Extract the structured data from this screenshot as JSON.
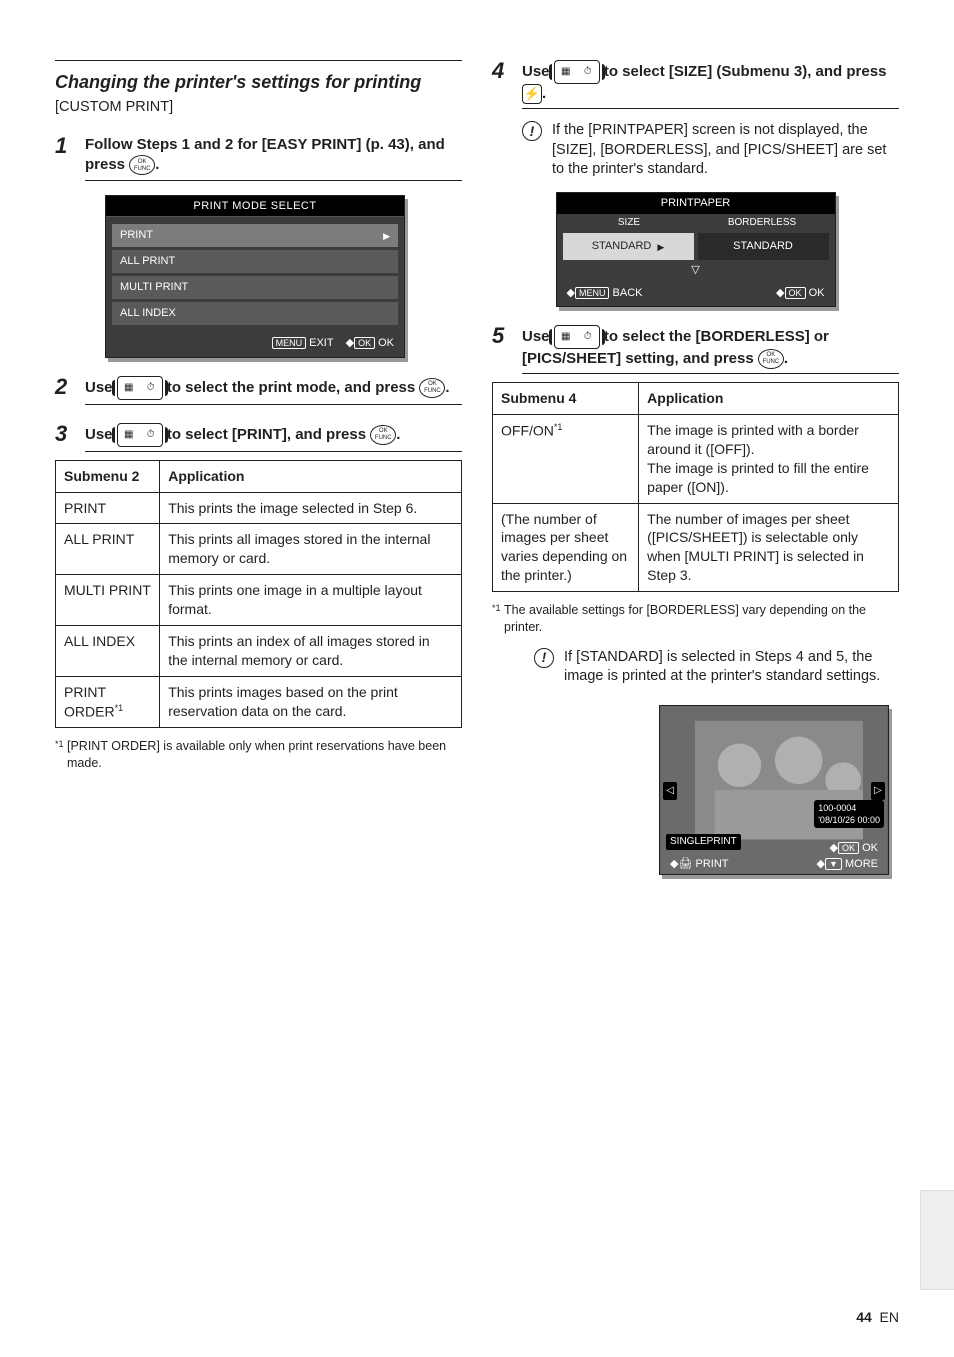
{
  "left": {
    "heading1": "Changing the printer's settings for printing",
    "heading1_sub": "[CUSTOM PRINT]",
    "step1_text_a": "Follow Steps 1 and 2 for [EASY PRINT] (p. 43), and press ",
    "step1_text_b": ".",
    "menu_title": "PRINT MODE SELECT",
    "menu_items": [
      "PRINT",
      "ALL PRINT",
      "MULTI PRINT",
      "ALL INDEX"
    ],
    "menu_foot_exit": "EXIT",
    "menu_foot_ok": "OK",
    "step2_text_a": "Use ",
    "step2_text_b": " to select the print mode, and press ",
    "step2_text_c": ".",
    "step3_text_a": "Use ",
    "step3_text_b": " to select [PRINT], and press ",
    "step3_text_c": ".",
    "table_hdr1": "Submenu 2",
    "table_hdr2": "Application",
    "table": [
      {
        "k": "PRINT",
        "v": "This prints the image selected in Step 6."
      },
      {
        "k": "ALL PRINT",
        "v": "This prints all images stored in the internal memory or card."
      },
      {
        "k": "MULTI PRINT",
        "v": "This prints one image in a multiple layout format."
      },
      {
        "k": "ALL INDEX",
        "v": "This prints an index of all images stored in the internal memory or card."
      },
      {
        "k": "PRINT ORDER*1",
        "v": "This prints images based on the print reservation data on the card."
      }
    ],
    "foot_sup": "*1",
    "foot_text": "[PRINT ORDER] is available only when print reservations have been made."
  },
  "right": {
    "step4_text_a": "Use ",
    "step4_text_b": " to select [SIZE] (Submenu 3), and press ",
    "step4_text_c": ".",
    "note1": "If the [PRINTPAPER] screen is not displayed, the [SIZE], [BORDERLESS], and [PICS/SHEET] are set to the printer's standard.",
    "paper_title": "PRINTPAPER",
    "paper_h1": "SIZE",
    "paper_h2": "BORDERLESS",
    "paper_v1": "STANDARD",
    "paper_v2": "STANDARD",
    "paper_back": "BACK",
    "paper_menu": "MENU",
    "paper_ok": "OK",
    "step5_text_a": "Use ",
    "step5_text_b": " to select the [BORDERLESS] or [PICS/SHEET] setting, and press ",
    "step5_text_c": ".",
    "table_hdr1": "Submenu 4",
    "table_hdr2": "Application",
    "row1_k": "OFF/ON*1",
    "row1_v": "The image is printed with a border around it ([OFF]).\nThe image is printed to fill the entire paper ([ON]).",
    "row2_k": "(The number of images per sheet varies depending on the printer.)",
    "row2_v": "The number of images per sheet ([PICS/SHEET]) is selectable only when [MULTI PRINT] is selected in Step 3.",
    "foot_sup": "*1",
    "foot_text": "The available settings for [BORDERLESS] vary depending on the printer.",
    "note2": "If [STANDARD] is selected in Steps 4 and 5, the image is printed at the printer's standard settings.",
    "photo_idx": "100-0004",
    "photo_date": "'08/10/26 00:00",
    "single_print": "SINGLEPRINT",
    "print_label": "PRINT",
    "more_label": "MORE",
    "page_num": "44",
    "page_label": "EN"
  }
}
